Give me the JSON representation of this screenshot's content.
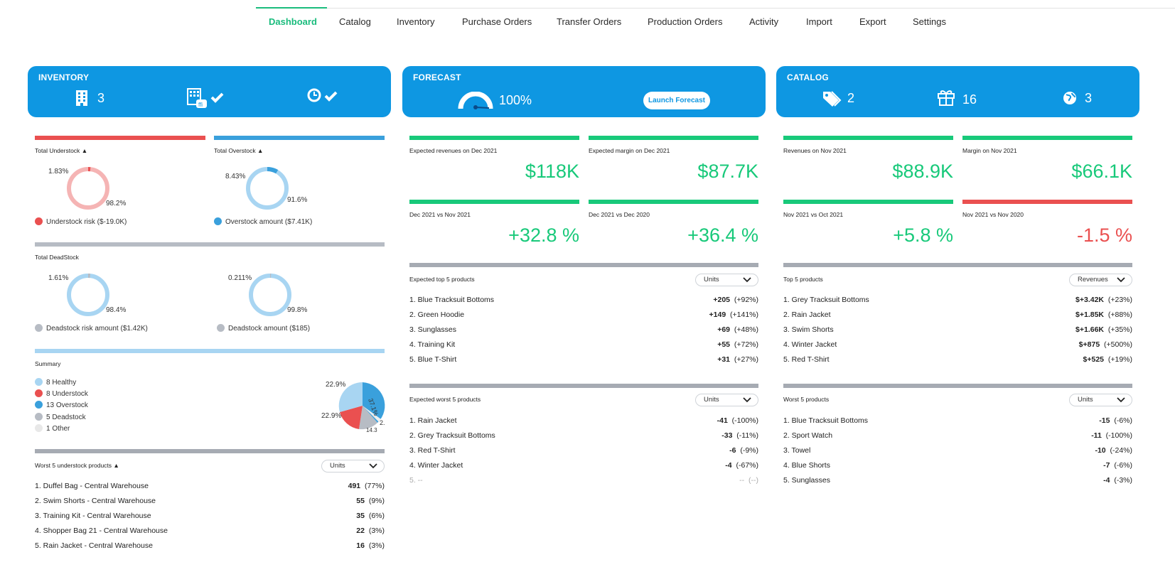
{
  "nav": {
    "tabs": [
      "Dashboard",
      "Catalog",
      "Inventory",
      "Purchase Orders",
      "Transfer Orders",
      "Production Orders",
      "Activity",
      "Import",
      "Export",
      "Settings"
    ],
    "active": "Dashboard",
    "accent": "#1abc7d"
  },
  "inventory_card": {
    "title": "INVENTORY",
    "warehouses": "3",
    "icons": [
      "building-icon",
      "warehouse-check-icon",
      "clock-check-icon"
    ]
  },
  "forecast_card": {
    "title": "FORECAST",
    "accuracy": "100%",
    "button": "Launch Forecast"
  },
  "catalog_card": {
    "title": "CATALOG",
    "tags": "2",
    "products": "16",
    "markets": "3"
  },
  "inventory": {
    "understock": {
      "title": "Total Understock",
      "pct_small": "1.83%",
      "pct_large": "98.2%",
      "legend": "Understock risk ($-19.0K)",
      "fraction": 0.0183
    },
    "overstock": {
      "title": "Total Overstock",
      "pct_small": "8.43%",
      "pct_large": "91.6%",
      "legend": "Overstock amount ($7.41K)",
      "fraction": 0.0843
    },
    "deadstock": {
      "title": "Total DeadStock",
      "risk": {
        "pct_small": "1.61%",
        "pct_large": "98.4%",
        "legend": "Deadstock risk amount ($1.42K)",
        "fraction": 0.0161
      },
      "amount": {
        "pct_small": "0.211%",
        "pct_large": "99.8%",
        "legend": "Deadstock amount ($185)",
        "fraction": 0.00211
      }
    },
    "summary": {
      "title": "Summary",
      "items": [
        {
          "label": "8 Healthy",
          "color": "#a8d5f2"
        },
        {
          "label": "8 Understock",
          "color": "#ea5050"
        },
        {
          "label": "13 Overstock",
          "color": "#3aa0dc"
        },
        {
          "label": "5 Deadstock",
          "color": "#b7bcc4"
        },
        {
          "label": "1 Other",
          "color": "#e8e8e8"
        }
      ],
      "pie_labels": {
        "a": "22.9%",
        "b": "22.9%",
        "c": "37.1%",
        "d": "2.",
        "e": "14.3"
      }
    },
    "worst_understock": {
      "title": "Worst 5 understock products",
      "select": "Units",
      "rows": [
        {
          "name": "1. Duffel Bag - Central Warehouse",
          "value": "491",
          "pct": "(77%)"
        },
        {
          "name": "2. Swim Shorts - Central Warehouse",
          "value": "55",
          "pct": "(9%)"
        },
        {
          "name": "3. Training Kit - Central Warehouse",
          "value": "35",
          "pct": "(6%)"
        },
        {
          "name": "4. Shopper Bag 21 - Central Warehouse",
          "value": "22",
          "pct": "(3%)"
        },
        {
          "name": "5. Rain Jacket - Central Warehouse",
          "value": "16",
          "pct": "(3%)"
        }
      ]
    }
  },
  "forecast": {
    "kpis": [
      {
        "label": "Expected revenues on Dec 2021",
        "value": "$118K"
      },
      {
        "label": "Expected margin on Dec 2021",
        "value": "$87.7K"
      },
      {
        "label": "Dec 2021 vs Nov 2021",
        "value": "+32.8 %"
      },
      {
        "label": "Dec 2021 vs Dec 2020",
        "value": "+36.4 %"
      }
    ],
    "top5": {
      "title": "Expected top 5 products",
      "select": "Units",
      "rows": [
        {
          "name": "1. Blue Tracksuit Bottoms",
          "value": "+205",
          "pct": "(+92%)"
        },
        {
          "name": "2. Green Hoodie",
          "value": "+149",
          "pct": "(+141%)"
        },
        {
          "name": "3. Sunglasses",
          "value": "+69",
          "pct": "(+48%)"
        },
        {
          "name": "4. Training Kit",
          "value": "+55",
          "pct": "(+72%)"
        },
        {
          "name": "5. Blue T-Shirt",
          "value": "+31",
          "pct": "(+27%)"
        }
      ]
    },
    "worst5": {
      "title": "Expected worst 5 products",
      "select": "Units",
      "rows": [
        {
          "name": "1. Rain Jacket",
          "value": "-41",
          "pct": "(-100%)"
        },
        {
          "name": "2. Grey Tracksuit Bottoms",
          "value": "-33",
          "pct": "(-11%)"
        },
        {
          "name": "3. Red T-Shirt",
          "value": "-6",
          "pct": "(-9%)"
        },
        {
          "name": "4. Winter Jacket",
          "value": "-4",
          "pct": "(-67%)"
        },
        {
          "name": "5. --",
          "value": "--",
          "pct": "(--)"
        }
      ]
    }
  },
  "catalog": {
    "kpis": [
      {
        "label": "Revenues on Nov 2021",
        "value": "$88.9K"
      },
      {
        "label": "Margin on Nov 2021",
        "value": "$66.1K"
      },
      {
        "label": "Nov 2021 vs Oct 2021",
        "value": "+5.8 %"
      },
      {
        "label": "Nov 2021 vs Nov 2020",
        "value": "-1.5 %"
      }
    ],
    "top5": {
      "title": "Top 5 products",
      "select": "Revenues",
      "rows": [
        {
          "name": "1. Grey Tracksuit Bottoms",
          "value": "$+3.42K",
          "pct": "(+23%)"
        },
        {
          "name": "2. Rain Jacket",
          "value": "$+1.85K",
          "pct": "(+88%)"
        },
        {
          "name": "3. Swim Shorts",
          "value": "$+1.66K",
          "pct": "(+35%)"
        },
        {
          "name": "4. Winter Jacket",
          "value": "$+875",
          "pct": "(+500%)"
        },
        {
          "name": "5. Red T-Shirt",
          "value": "$+525",
          "pct": "(+19%)"
        }
      ]
    },
    "worst5": {
      "title": "Worst 5 products",
      "select": "Units",
      "rows": [
        {
          "name": "1. Blue Tracksuit Bottoms",
          "value": "-15",
          "pct": "(-6%)"
        },
        {
          "name": "2. Sport Watch",
          "value": "-11",
          "pct": "(-100%)"
        },
        {
          "name": "3. Towel",
          "value": "-10",
          "pct": "(-24%)"
        },
        {
          "name": "4. Blue Shorts",
          "value": "-7",
          "pct": "(-6%)"
        },
        {
          "name": "5. Sunglasses",
          "value": "-4",
          "pct": "(-3%)"
        }
      ]
    }
  }
}
